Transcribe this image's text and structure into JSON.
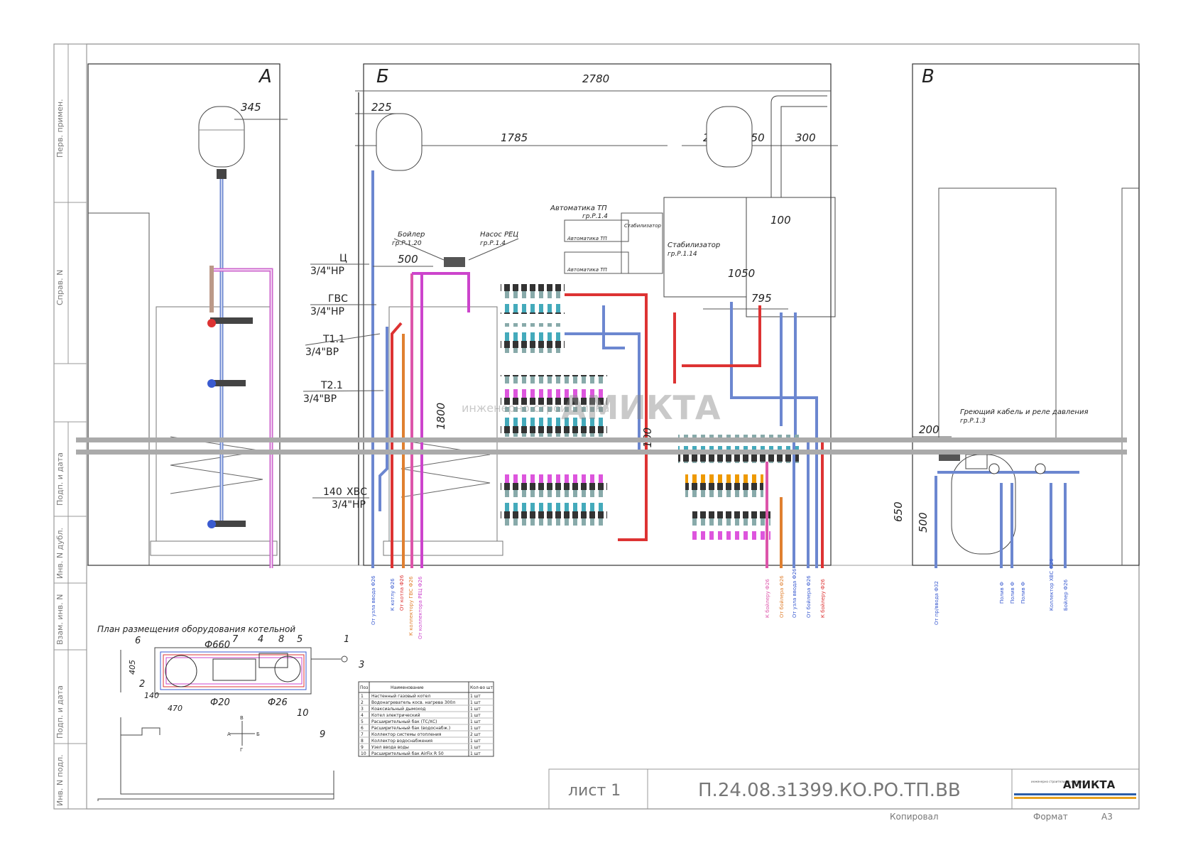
{
  "side_stamps": [
    "Перв. примен.",
    "Справ. N",
    "Подп. и дата",
    "Инв. N дубл.",
    "Взам. инв. N",
    "Подп. и дата",
    "Инв. N подл."
  ],
  "views": {
    "a": {
      "letter": "А",
      "dim_tank": "345"
    },
    "b": {
      "letter": "Б",
      "dims": {
        "w_total": "2780",
        "w_1785": "1785",
        "w_225": "225",
        "w_500": "500",
        "w_250a": "250",
        "w_250b": "250",
        "w_300": "300",
        "w_100": "100",
        "w_1050": "1050",
        "w_795": "795",
        "h_1800": "1800",
        "h_1100": "1100",
        "w_140": "140"
      },
      "callouts": {
        "boiler": [
          "Бойлер",
          "гр.Р.1.20"
        ],
        "pump": [
          "Насос РЕЦ",
          "гр.Р.1.4"
        ],
        "automation": [
          "Автоматика ТП",
          "гр.Р.1.4"
        ],
        "stabilizer": [
          "Стабилизатор",
          "гр.Р.1.14"
        ],
        "ports": [
          "Ц",
          "3/4\"НР",
          "ГВС",
          "3/4\"НР",
          "Т1.1",
          "3/4\"ВР",
          "Т2.1",
          "3/4\"ВР",
          "ХВС",
          "3/4\"НР"
        ]
      },
      "box_labels": [
        "Стабилизатор",
        "Автоматика ТП",
        "Автоматика ТП"
      ],
      "bottom_left": [
        "От узла ввода Ф26",
        "К котлу Ф26",
        "От котла Ф26",
        "К коллектору ГВС Ф26",
        "От коллектора РЕЦ Ф26"
      ],
      "bottom_right": [
        "К бойлеру Ф26",
        "От бойлера Ф26",
        "От узла ввода Ф26",
        "От бойлера Ф26",
        "К бойлеру Ф26"
      ]
    },
    "v": {
      "letter": "В",
      "callout": [
        "Греющий кабель и реле давления",
        "гр.Р.1.3"
      ],
      "dims": {
        "w_200": "200",
        "h_650": "650",
        "h_500": "500"
      },
      "bottom": [
        "От пр/ввода Ф32",
        "Полив Ф",
        "Полив Ф",
        "Полив Ф",
        "Коллектор ХВС Ф26",
        "Бойлер Ф26"
      ]
    }
  },
  "plan": {
    "title": "План размещения оборудования котельной",
    "labels": [
      "1",
      "2",
      "3",
      "4",
      "5",
      "6",
      "7",
      "8",
      "9",
      "10",
      "Ф660",
      "Ф20",
      "Ф26",
      "405",
      "140",
      "470"
    ],
    "compass": [
      "А",
      "Б",
      "В",
      "Г"
    ]
  },
  "spec_table": {
    "headers": [
      "Поз",
      "Наименование",
      "Кол-во шт"
    ],
    "rows": [
      [
        "1",
        "Настенный газовый котел",
        "1 шт"
      ],
      [
        "2",
        "Водонагреватель косв. нагрева 300л",
        "1 шт"
      ],
      [
        "3",
        "Коаксиальный дымоход",
        "1 шт"
      ],
      [
        "4",
        "Котел электрический",
        "1 шт"
      ],
      [
        "5",
        "Расширительный бак (ТС/ХС)",
        "1 шт"
      ],
      [
        "6",
        "Расширительный бак (водоснабж.)",
        "1 шт"
      ],
      [
        "7",
        "Коллектор системы отопления",
        "2 шт"
      ],
      [
        "8",
        "Коллектор водоснабжения",
        "1 шт"
      ],
      [
        "9",
        "Узел ввода воды",
        "1 шт"
      ],
      [
        "10",
        "Расширительный бак AirFix R 50",
        "1 шт"
      ]
    ]
  },
  "watermark": {
    "small": "инженерно строительная",
    "big": "АМИКТА"
  },
  "title_block": {
    "sheet": "лист 1",
    "code": "П.24.08.з1399.КО.РО.ТП.ВВ",
    "logo_small": "инженерно строительная компания",
    "logo_big": "АМИКТА",
    "copied": "Копировал",
    "format_label": "Формат",
    "format_value": "А3"
  },
  "colors": {
    "hot": "#d33",
    "cold": "#3a5bd0",
    "hot_water": "#e08030",
    "recirc": "#cc44cc",
    "accent_stripe_blue": "#2a5ca8",
    "accent_stripe_orange": "#e8a020"
  }
}
